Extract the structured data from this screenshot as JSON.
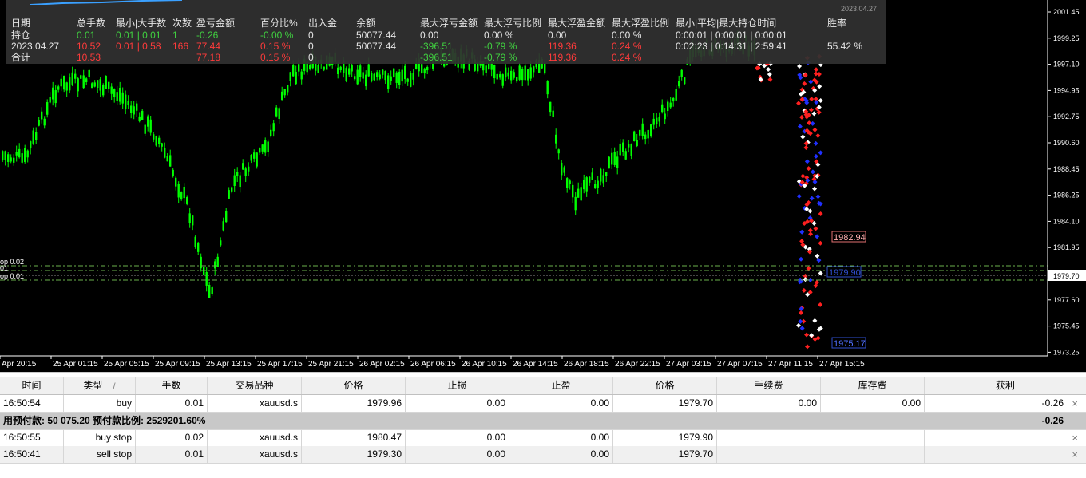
{
  "chart": {
    "symbol": "XAUUSD",
    "bg_color": "#000000",
    "candle_color": "#00ff00",
    "current_price": "1979.70",
    "price_axis": [
      "2001.45",
      "1999.25",
      "1997.10",
      "1994.95",
      "1992.75",
      "1990.60",
      "1988.45",
      "1986.25",
      "1984.10",
      "1981.95",
      "1979.70",
      "1977.60",
      "1975.45",
      "1973.25"
    ],
    "time_axis": [
      "Apr 20:15",
      "25 Apr 01:15",
      "25 Apr 05:15",
      "25 Apr 09:15",
      "25 Apr 13:15",
      "25 Apr 17:15",
      "25 Apr 21:15",
      "26 Apr 02:15",
      "26 Apr 06:15",
      "26 Apr 10:15",
      "26 Apr 14:15",
      "26 Apr 18:15",
      "26 Apr 22:15",
      "27 Apr 03:15",
      "27 Apr 07:15",
      "27 Apr 11:15",
      "27 Apr 15:15"
    ],
    "price_tags": {
      "upper": "1982.94",
      "middle": "1979.90",
      "lower": "1975.17"
    },
    "order_lines": {
      "line1": "op 0.02",
      "line2": "01",
      "line3": "op 0.01"
    }
  },
  "stats": {
    "date_stamp": "2023.04.27",
    "headers": [
      "日期",
      "总手数",
      "最小|大手数",
      "次数",
      "盈亏金额",
      "百分比%",
      "出入金",
      "余额",
      "最大浮亏金额",
      "最大浮亏比例",
      "最大浮盈金额",
      "最大浮盈比例",
      "最小|平均|最大持仓时间",
      "胜率"
    ],
    "rows": [
      {
        "date": "持仓",
        "total_lots": "0.01",
        "minmax_lots": "0.01 | 0.01",
        "count": "1",
        "pnl": "-0.26",
        "pct": "-0.00 %",
        "inout": "0",
        "balance": "50077.44",
        "max_float_loss": "0.00",
        "max_float_loss_pct": "0.00 %",
        "max_float_profit": "0.00",
        "max_float_profit_pct": "0.00 %",
        "hold_time": "0:00:01 | 0:00:01 | 0:00:01",
        "win_rate": ""
      },
      {
        "date": "2023.04.27",
        "total_lots": "10.52",
        "minmax_lots": "0.01 | 0.58",
        "count": "166",
        "pnl": "77.44",
        "pct": "0.15 %",
        "inout": "0",
        "balance": "50077.44",
        "max_float_loss": "-396.51",
        "max_float_loss_pct": "-0.79 %",
        "max_float_profit": "119.36",
        "max_float_profit_pct": "0.24 %",
        "hold_time": "0:02:23 | 0:14:31 | 2:59:41",
        "win_rate": "55.42 %"
      },
      {
        "date": "合计",
        "total_lots": "10.53",
        "minmax_lots": "",
        "count": "",
        "pnl": "77.18",
        "pct": "0.15 %",
        "inout": "0",
        "balance": "",
        "max_float_loss": "-396.51",
        "max_float_loss_pct": "-0.79 %",
        "max_float_profit": "119.36",
        "max_float_profit_pct": "0.24 %",
        "hold_time": "",
        "win_rate": ""
      }
    ]
  },
  "terminal": {
    "columns": [
      "时间",
      "类型",
      "手数",
      "交易品种",
      "价格",
      "止损",
      "止盈",
      "价格",
      "手续费",
      "库存费",
      "获利"
    ],
    "sort_indicator": "/",
    "positions": [
      {
        "time": "16:50:54",
        "type": "buy",
        "lots": "0.01",
        "symbol": "xauusd.s",
        "open_price": "1979.96",
        "sl": "0.00",
        "tp": "0.00",
        "price": "1979.70",
        "commission": "0.00",
        "swap": "0.00",
        "profit": "-0.26"
      }
    ],
    "summary": {
      "text": "用预付款: 50 075.20  预付款比例: 2529201.60%",
      "profit": "-0.26"
    },
    "orders": [
      {
        "time": "16:50:55",
        "type": "buy stop",
        "lots": "0.02",
        "symbol": "xauusd.s",
        "open_price": "1980.47",
        "sl": "0.00",
        "tp": "0.00",
        "price": "1979.90"
      },
      {
        "time": "16:50:41",
        "type": "sell stop",
        "lots": "0.01",
        "symbol": "xauusd.s",
        "open_price": "1979.30",
        "sl": "0.00",
        "tp": "0.00",
        "price": "1979.70"
      }
    ],
    "close_glyph": "×"
  }
}
